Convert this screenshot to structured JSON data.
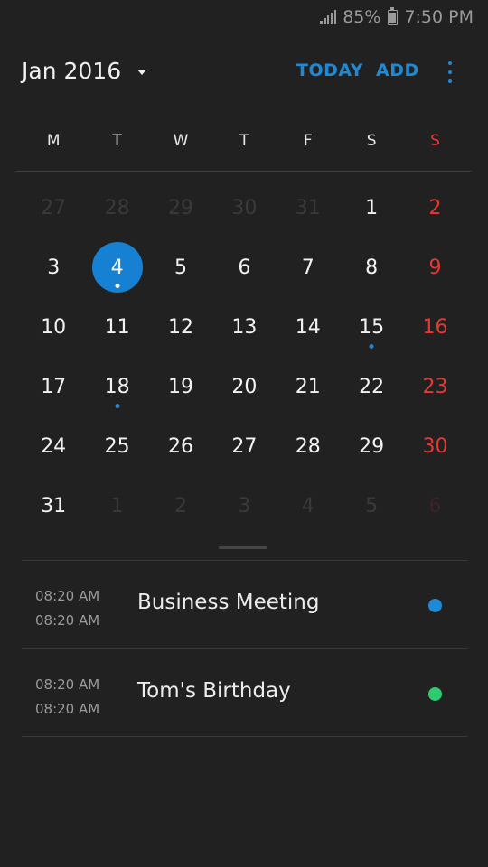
{
  "status_bar": {
    "battery_percent": "85%",
    "time": "7:50 PM"
  },
  "header": {
    "month_title": "Jan 2016",
    "today_label": "TODAY",
    "add_label": "ADD"
  },
  "weekdays": [
    "M",
    "T",
    "W",
    "T",
    "F",
    "S",
    "S"
  ],
  "calendar": {
    "days": [
      {
        "label": "27",
        "muted": true
      },
      {
        "label": "28",
        "muted": true
      },
      {
        "label": "29",
        "muted": true
      },
      {
        "label": "30",
        "muted": true
      },
      {
        "label": "31",
        "muted": true
      },
      {
        "label": "1"
      },
      {
        "label": "2",
        "sunday": true
      },
      {
        "label": "3"
      },
      {
        "label": "4",
        "selected": true,
        "event": true
      },
      {
        "label": "5"
      },
      {
        "label": "6"
      },
      {
        "label": "7"
      },
      {
        "label": "8"
      },
      {
        "label": "9",
        "sunday": true
      },
      {
        "label": "10"
      },
      {
        "label": "11"
      },
      {
        "label": "12"
      },
      {
        "label": "13"
      },
      {
        "label": "14"
      },
      {
        "label": "15",
        "event": true
      },
      {
        "label": "16",
        "sunday": true
      },
      {
        "label": "17"
      },
      {
        "label": "18",
        "event": true
      },
      {
        "label": "19"
      },
      {
        "label": "20"
      },
      {
        "label": "21"
      },
      {
        "label": "22"
      },
      {
        "label": "23",
        "sunday": true
      },
      {
        "label": "24"
      },
      {
        "label": "25"
      },
      {
        "label": "26"
      },
      {
        "label": "27"
      },
      {
        "label": "28"
      },
      {
        "label": "29"
      },
      {
        "label": "30",
        "sunday": true
      },
      {
        "label": "31"
      },
      {
        "label": "1",
        "muted": true
      },
      {
        "label": "2",
        "muted": true
      },
      {
        "label": "3",
        "muted": true
      },
      {
        "label": "4",
        "muted": true
      },
      {
        "label": "5",
        "muted": true
      },
      {
        "label": "6",
        "muted": true,
        "sunday": true
      }
    ]
  },
  "events": [
    {
      "start": "08:20 AM",
      "end": "08:20 AM",
      "title": "Business Meeting",
      "color": "#1e8ad6"
    },
    {
      "start": "08:20 AM",
      "end": "08:20 AM",
      "title": "Tom's Birthday",
      "color": "#2ecc71"
    }
  ],
  "colors": {
    "accent": "#1e8ad6",
    "sunday": "#e53935",
    "background": "#212121"
  }
}
